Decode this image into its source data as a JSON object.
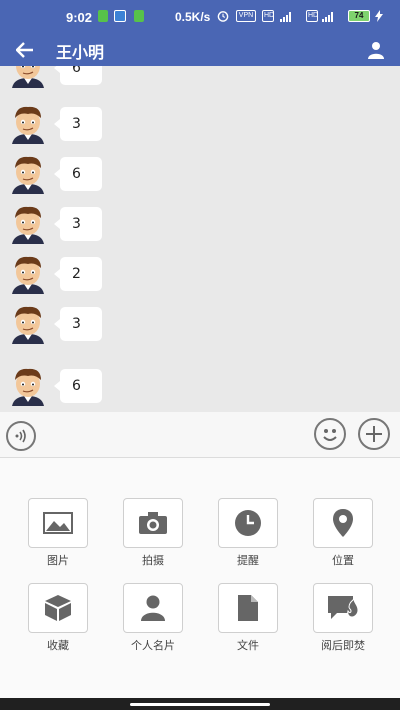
{
  "status_bar": {
    "time": "9:02",
    "speed": "0.5K/s",
    "battery": "74"
  },
  "header": {
    "title": "王小明"
  },
  "messages": [
    "6",
    "3",
    "6",
    "3",
    "2",
    "3",
    "6"
  ],
  "tools": [
    {
      "label": "图片",
      "icon": "image-icon"
    },
    {
      "label": "拍摄",
      "icon": "camera-icon"
    },
    {
      "label": "提醒",
      "icon": "clock-icon"
    },
    {
      "label": "位置",
      "icon": "location-pin-icon"
    },
    {
      "label": "收藏",
      "icon": "cube-icon"
    },
    {
      "label": "个人名片",
      "icon": "person-card-icon"
    },
    {
      "label": "文件",
      "icon": "file-icon"
    },
    {
      "label": "阅后即焚",
      "icon": "burn-after-read-icon"
    }
  ],
  "colors": {
    "header_bg": "#4a66b4",
    "chat_bg": "#e9e9e9",
    "icon_gray": "#666666"
  }
}
